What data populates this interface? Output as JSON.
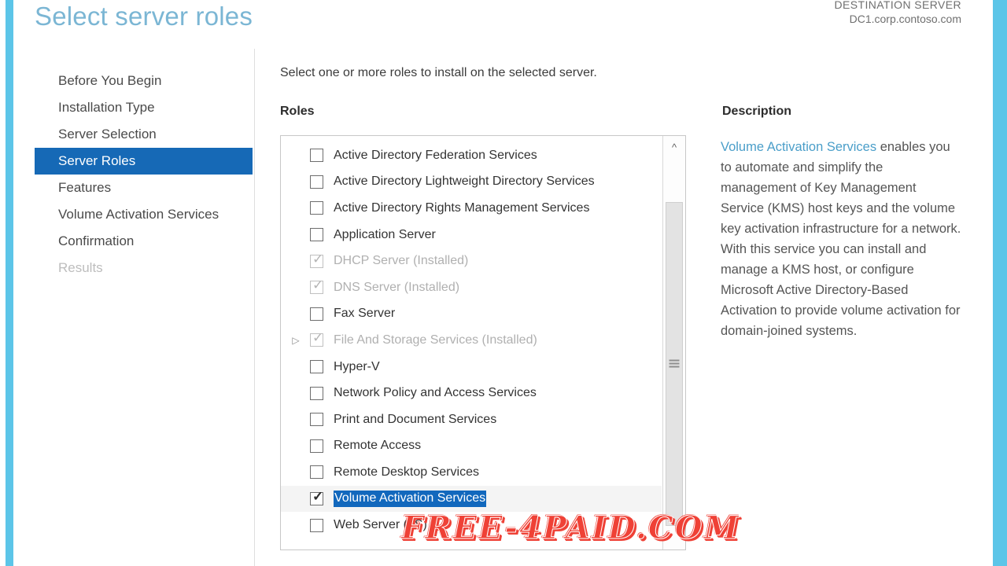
{
  "header": {
    "title": "Select server roles",
    "destination_label": "DESTINATION SERVER",
    "destination_server": "DC1.corp.contoso.com"
  },
  "colors": {
    "accent_bar": "#5cc5e8",
    "title": "#7bb6d4",
    "nav_selected": "#1669b6",
    "text_selection": "#1268bd",
    "link": "#4a9ec9",
    "watermark": "#ef4136"
  },
  "sidebar": {
    "items": [
      {
        "label": "Before You Begin",
        "state": "normal"
      },
      {
        "label": "Installation Type",
        "state": "normal"
      },
      {
        "label": "Server Selection",
        "state": "normal"
      },
      {
        "label": "Server Roles",
        "state": "selected"
      },
      {
        "label": "Features",
        "state": "normal"
      },
      {
        "label": "Volume Activation Services",
        "state": "normal"
      },
      {
        "label": "Confirmation",
        "state": "normal"
      },
      {
        "label": "Results",
        "state": "disabled"
      }
    ]
  },
  "main": {
    "intro": "Select one or more roles to install on the selected server.",
    "roles_label": "Roles",
    "roles": [
      {
        "label": "Active Directory Federation Services",
        "checked": false,
        "installed": false,
        "expandable": false,
        "selected": false
      },
      {
        "label": "Active Directory Lightweight Directory Services",
        "checked": false,
        "installed": false,
        "expandable": false,
        "selected": false
      },
      {
        "label": "Active Directory Rights Management Services",
        "checked": false,
        "installed": false,
        "expandable": false,
        "selected": false
      },
      {
        "label": "Application Server",
        "checked": false,
        "installed": false,
        "expandable": false,
        "selected": false
      },
      {
        "label": "DHCP Server (Installed)",
        "checked": true,
        "installed": true,
        "expandable": false,
        "selected": false
      },
      {
        "label": "DNS Server (Installed)",
        "checked": true,
        "installed": true,
        "expandable": false,
        "selected": false
      },
      {
        "label": "Fax Server",
        "checked": false,
        "installed": false,
        "expandable": false,
        "selected": false
      },
      {
        "label": "File And Storage Services (Installed)",
        "checked": true,
        "installed": true,
        "expandable": true,
        "selected": false
      },
      {
        "label": "Hyper-V",
        "checked": false,
        "installed": false,
        "expandable": false,
        "selected": false
      },
      {
        "label": "Network Policy and Access Services",
        "checked": false,
        "installed": false,
        "expandable": false,
        "selected": false
      },
      {
        "label": "Print and Document Services",
        "checked": false,
        "installed": false,
        "expandable": false,
        "selected": false
      },
      {
        "label": "Remote Access",
        "checked": false,
        "installed": false,
        "expandable": false,
        "selected": false
      },
      {
        "label": "Remote Desktop Services",
        "checked": false,
        "installed": false,
        "expandable": false,
        "selected": false
      },
      {
        "label": "Volume Activation Services",
        "checked": true,
        "installed": false,
        "expandable": false,
        "selected": true
      },
      {
        "label": "Web Server (IIS)",
        "checked": false,
        "installed": false,
        "expandable": false,
        "selected": false
      }
    ],
    "scrollbar": {
      "up_arrow_icon": "chevron-up-icon",
      "grip_icon": "scrollbar-grip-icon"
    },
    "expander_icon": "triangle-right-icon",
    "check_glyph": "✓"
  },
  "description": {
    "title": "Description",
    "link_text": "Volume Activation Services",
    "body": " enables you to automate and simplify the management of Key Management Service (KMS) host keys and the volume key activation infrastructure for a network. With this service you can install and manage a KMS host, or configure Microsoft Active Directory-Based Activation to provide volume activation for domain-joined systems."
  },
  "watermark": {
    "text": "FREE-4PAID.COM"
  }
}
